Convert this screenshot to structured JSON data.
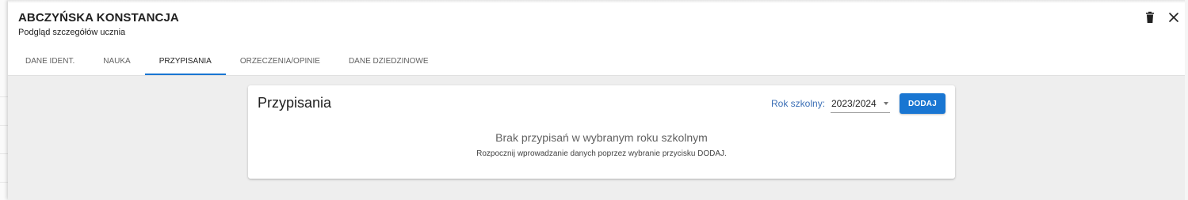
{
  "header": {
    "title": "ABCZYŃSKA KONSTANCJA",
    "subtitle": "Podgląd szczegółów ucznia",
    "icons": [
      "trash-icon",
      "close-icon"
    ]
  },
  "tabs": [
    {
      "label": "DANE IDENT.",
      "active": false
    },
    {
      "label": "NAUKA",
      "active": false
    },
    {
      "label": "PRZYPISANIA",
      "active": true
    },
    {
      "label": "ORZECZENIA/OPINIE",
      "active": false
    },
    {
      "label": "DANE DZIEDZINOWE",
      "active": false
    }
  ],
  "card": {
    "title": "Przypisania",
    "school_year_label": "Rok szkolny:",
    "school_year_value": "2023/2024",
    "add_button_label": "DODAJ",
    "empty_title": "Brak przypisań w wybranym roku szkolnym",
    "empty_description": "Rozpocznij wprowadzanie danych poprzez wybranie przycisku DODAJ."
  },
  "colors": {
    "accent": "#1976d2",
    "label_blue": "#3b6fb6",
    "content_background": "#eeeeee"
  }
}
